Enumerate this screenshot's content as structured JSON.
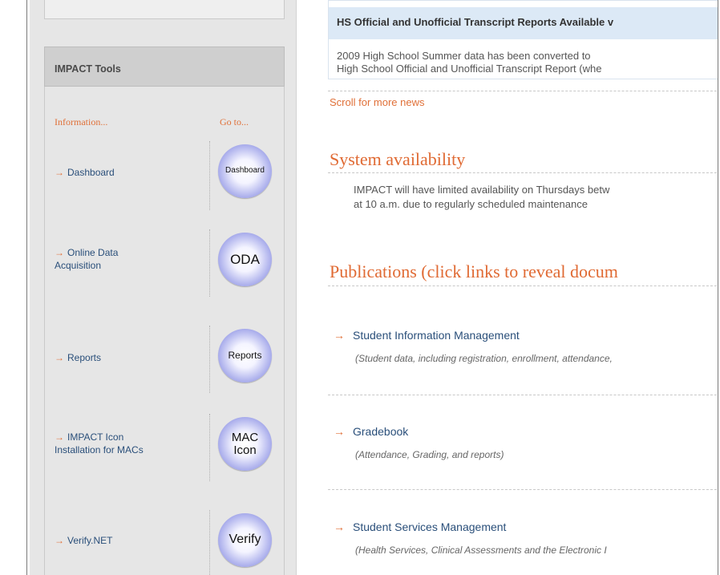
{
  "sidebar": {
    "tools_title": "IMPACT Tools",
    "col_info": "Information...",
    "col_goto": "Go to...",
    "tools": [
      {
        "label": "Dashboard",
        "button": "Dashboard"
      },
      {
        "label": "Online Data Acquisition",
        "button": "ODA"
      },
      {
        "label": "Reports",
        "button": "Reports"
      },
      {
        "label": "IMPACT Icon Installation for MACs",
        "button": "MAC Icon"
      },
      {
        "label": "Verify.NET",
        "button": "Verify"
      }
    ]
  },
  "news": {
    "title": "HS Official and Unofficial Transcript Reports Available v",
    "body_line1": "2009 High School Summer data has been converted to",
    "body_line2": "High School Official and Unofficial Transcript Report (whe",
    "scroll_link": "Scroll for more news"
  },
  "availability": {
    "title": "System availability",
    "line1": "IMPACT will have limited availability on Thursdays betw",
    "line2": "at 10 a.m. due to regularly scheduled maintenance"
  },
  "publications": {
    "title": "Publications (click links to reveal docum",
    "items": [
      {
        "label": "Student Information Management",
        "desc": "(Student data, including registration, enrollment, attendance,"
      },
      {
        "label": "Gradebook",
        "desc": "(Attendance, Grading, and reports)"
      },
      {
        "label": "Student Services Management",
        "desc": "(Health Services, Clinical Assessments and the Electronic I"
      }
    ]
  },
  "colors": {
    "accent": "#e06a33",
    "link": "#2a4f7a",
    "button": "#8a8ee0"
  }
}
